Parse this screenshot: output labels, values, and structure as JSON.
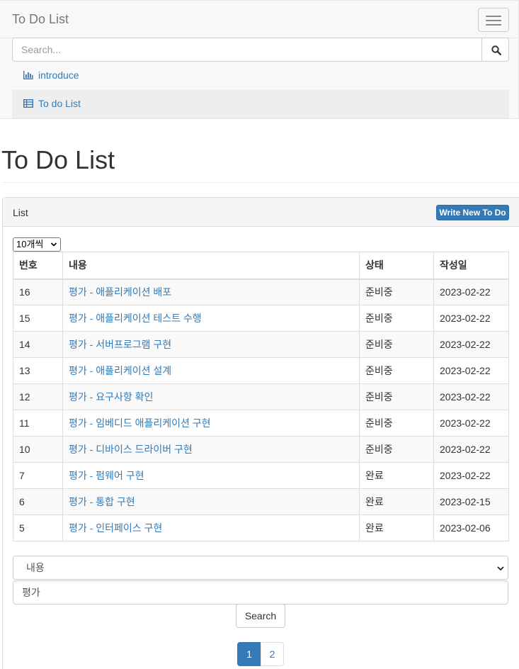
{
  "navbar": {
    "brand": "To Do List",
    "search": {
      "placeholder": "Search..."
    },
    "items": [
      {
        "label": "introduce",
        "icon": "bar-chart-icon"
      },
      {
        "label": "To do List",
        "icon": "table-icon"
      }
    ]
  },
  "page": {
    "title": "To Do List"
  },
  "panel": {
    "heading": "List",
    "write_button": "Write New To Do",
    "per_page": "10개씩",
    "columns": [
      "번호",
      "내용",
      "상태",
      "작성일"
    ],
    "rows": [
      {
        "no": "16",
        "content": "평가 - 애플리케이션 배포",
        "status": "준비중",
        "date": "2023-02-22"
      },
      {
        "no": "15",
        "content": "평가 - 애플리케이션 테스트 수행",
        "status": "준비중",
        "date": "2023-02-22"
      },
      {
        "no": "14",
        "content": "평가 - 서버프로그램 구현",
        "status": "준비중",
        "date": "2023-02-22"
      },
      {
        "no": "13",
        "content": "평가 - 애플리케이션 설계",
        "status": "준비중",
        "date": "2023-02-22"
      },
      {
        "no": "12",
        "content": "평가 - 요구사항 확인",
        "status": "준비중",
        "date": "2023-02-22"
      },
      {
        "no": "11",
        "content": "평가 - 임베디드 애플리케이션 구현",
        "status": "준비중",
        "date": "2023-02-22"
      },
      {
        "no": "10",
        "content": "평가 - 디바이스 드라이버 구현",
        "status": "준비중",
        "date": "2023-02-22"
      },
      {
        "no": "7",
        "content": "평가 - 펌웨어 구현",
        "status": "완료",
        "date": "2023-02-22"
      },
      {
        "no": "6",
        "content": "평가 - 통합 구현",
        "status": "완료",
        "date": "2023-02-15"
      },
      {
        "no": "5",
        "content": "평가 - 인터페이스 구현",
        "status": "완료",
        "date": "2023-02-06"
      }
    ]
  },
  "filter": {
    "field": "내용",
    "keyword": "평가",
    "search_button": "Search"
  },
  "pagination": {
    "pages": [
      "1",
      "2"
    ],
    "current": "1"
  },
  "colors": {
    "accent": "#337ab7",
    "link": "#337ab7",
    "navbar_bg": "#f8f8f8"
  }
}
